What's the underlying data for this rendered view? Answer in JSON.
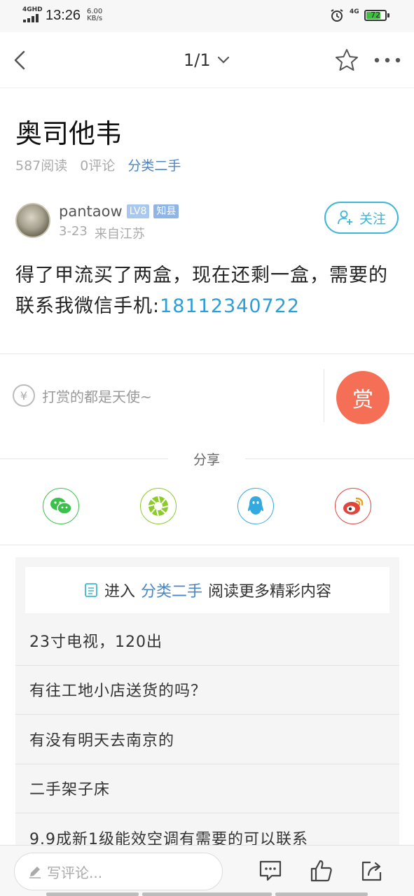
{
  "status_bar": {
    "network": "4GHD",
    "time": "13:26",
    "speed_value": "6.00",
    "speed_unit": "KB/s",
    "network2": "4G",
    "battery": "72"
  },
  "header": {
    "pager": "1/1"
  },
  "article": {
    "title": "奥司他韦",
    "reads": "587阅读",
    "comments": "0评论",
    "category": "分类二手",
    "author": {
      "name": "pantaow",
      "level": "LV8",
      "badge": "知县",
      "date": "3-23",
      "from": "来自江苏"
    },
    "follow_label": "关注",
    "body_text": "得了甲流买了两盒，现在还剩一盒，需要的联系我微信手机:",
    "phone": "18112340722"
  },
  "reward": {
    "hint": "打赏的都是天使~",
    "yuan_symbol": "¥",
    "button_label": "赏"
  },
  "share": {
    "label": "分享",
    "targets": [
      "wechat-icon",
      "moments-icon",
      "qq-icon",
      "weibo-icon"
    ],
    "colors": {
      "wechat": "#3cc04c",
      "moments": "#8ccc2a",
      "qq": "#34a9e0",
      "weibo": "#e0443a"
    }
  },
  "more": {
    "prefix": "进入",
    "category": "分类二手",
    "suffix": "阅读更多精彩内容",
    "items": [
      "23寸电视，120出",
      "有往工地小店送货的吗？",
      "有没有明天去南京的",
      "二手架子床",
      "9.9成新1级能效空调有需要的可以联系"
    ]
  },
  "bottom_bar": {
    "comment_placeholder": "写评论..."
  },
  "colors": {
    "accent_blue": "#3eb6d6",
    "link_blue": "#4a86c5",
    "reward_red": "#f46f55"
  }
}
